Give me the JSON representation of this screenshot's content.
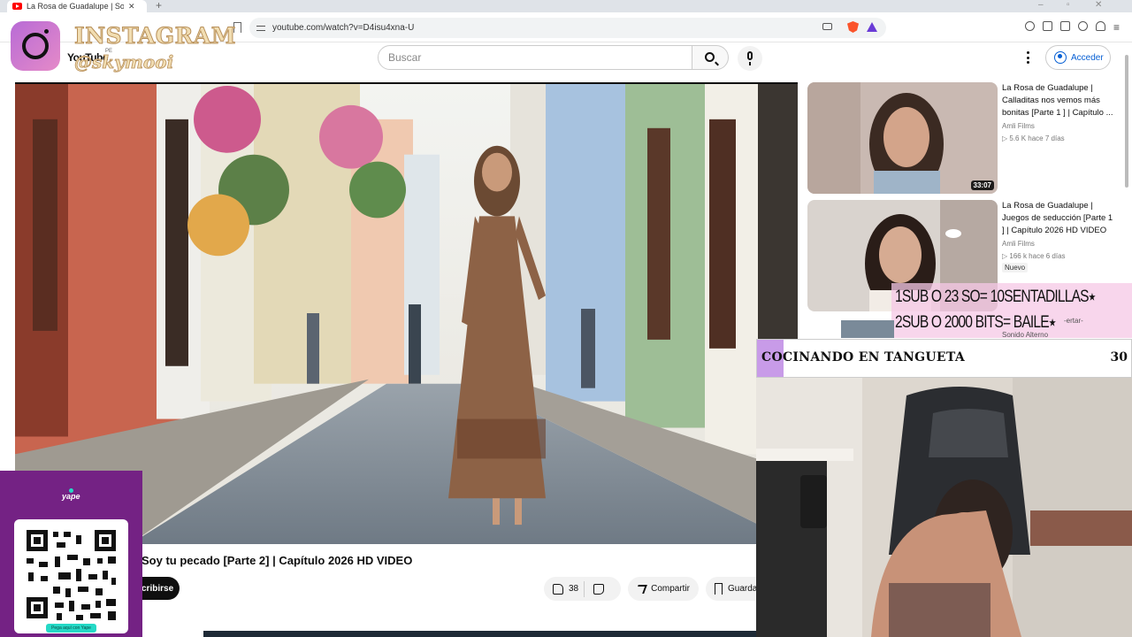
{
  "browser": {
    "tab_title": "La Rosa de Guadalupe | Soy tu p",
    "new_tab_symbol": "+",
    "url": "youtube.com/watch?v=D4isu4xna-U"
  },
  "youtube": {
    "logo_text": "YouTube",
    "region": "PE",
    "search_placeholder": "Buscar",
    "signin_label": "Acceder",
    "video_title": "Soy tu pecado [Parte 2] | Capítulo 2026 HD VIDEO",
    "subscribe_label": "Suscribirse",
    "subscribe_visible": "cribirse",
    "like_count": "38",
    "share_label": "Compartir",
    "save_label": "Guardar",
    "save_visible": "Guarda"
  },
  "recommendations": [
    {
      "title": "La Rosa de Guadalupe | Calladitas nos vemos más bonitas [Parte 1 ] | Capítulo ...",
      "channel": "Amli Films",
      "meta": "▷ 5.6 K   hace 7 días",
      "duration": "33:07"
    },
    {
      "title": "La Rosa de Guadalupe | Juegos de seducción [Parte 1 ] | Capítulo 2026 HD VIDEO",
      "channel": "Amli Films",
      "meta": "▷ 166 k   hace 6 días",
      "badge": "Nuevo"
    }
  ],
  "overlay": {
    "instagram_label": "INSTAGRAM",
    "instagram_user": "@skymooi",
    "goal_line_1": "1SUB O 23 SO= 10SENTADILLAS⭑",
    "goal_line_2": "2SUB O 2000 BITS= BAILE⭑",
    "goal_peek": "-ertar-",
    "under_text": "Sonido Alterno",
    "cooking_text": "COCINANDO EN TANGUETA",
    "cooking_number": "30",
    "yape_logo": "yape",
    "yape_caption": "Pega aquí con Yape"
  },
  "colors": {
    "youtube_red": "#ff0000",
    "link_blue": "#065fd4",
    "yape_purple": "#742284",
    "yape_teal": "#25d9c6",
    "instagram_gold": "#f1ddb2"
  }
}
